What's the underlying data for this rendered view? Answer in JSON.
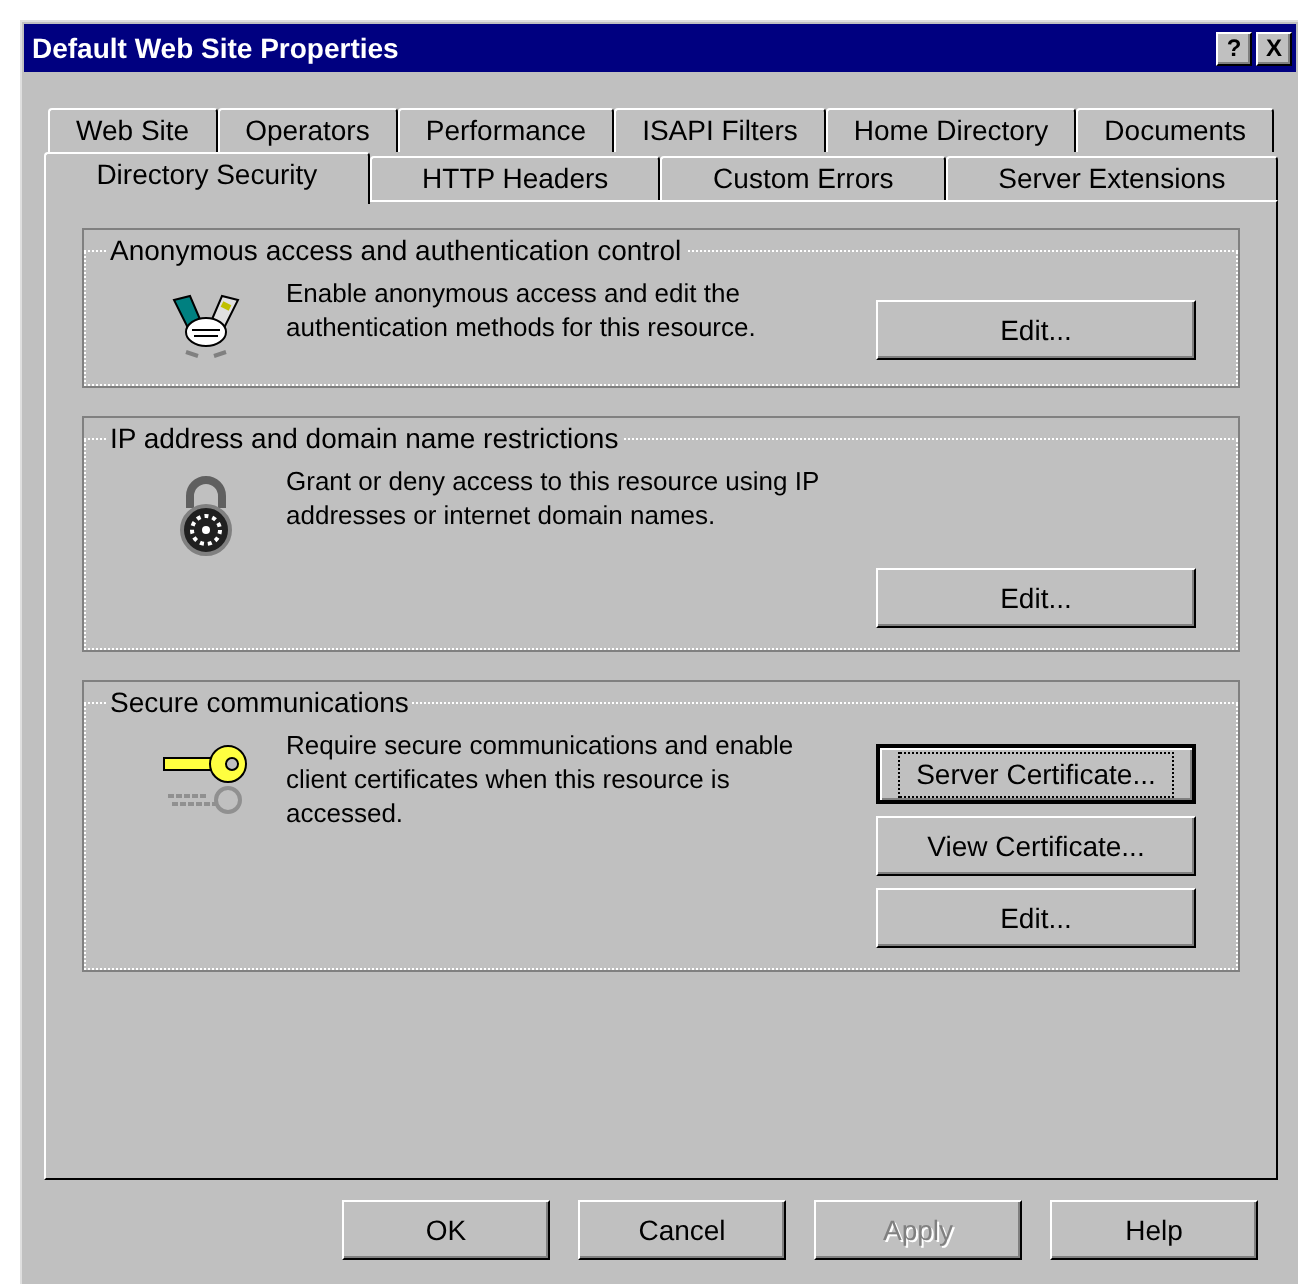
{
  "window": {
    "title": "Default Web Site Properties",
    "title_buttons": [
      "?",
      "X"
    ]
  },
  "tab_rows": [
    {
      "tabs": [
        {
          "label": "Web Site",
          "selected": false
        },
        {
          "label": "Operators",
          "selected": false
        },
        {
          "label": "Performance",
          "selected": false
        },
        {
          "label": "ISAPI Filters",
          "selected": false
        },
        {
          "label": "Home Directory",
          "selected": false
        },
        {
          "label": "Documents",
          "selected": false
        }
      ]
    },
    {
      "tabs": [
        {
          "label": "Directory Security",
          "selected": true
        },
        {
          "label": "HTTP Headers",
          "selected": false
        },
        {
          "label": "Custom Errors",
          "selected": false
        },
        {
          "label": "Server Extensions",
          "selected": false
        }
      ]
    }
  ],
  "groups": [
    {
      "title": "Anonymous access and authentication control",
      "kind": "handshake",
      "description": "Enable anonymous access and edit the authentication methods for this resource.",
      "buttons": [
        {
          "label": "Edit...",
          "focused": false
        }
      ]
    },
    {
      "title": "IP address and domain name restrictions",
      "kind": "lock",
      "description": "Grant or deny access to this resource using IP addresses or internet domain names.",
      "buttons": [
        {
          "label": "Edit...",
          "focused": false
        }
      ]
    },
    {
      "title": "Secure communications",
      "kind": "key",
      "description": "Require secure communications and enable client certificates when this resource is accessed.",
      "buttons": [
        {
          "label": "Server Certificate...",
          "focused": true
        },
        {
          "label": "View Certificate...",
          "focused": false
        },
        {
          "label": "Edit...",
          "focused": false
        }
      ]
    }
  ],
  "footer_buttons": [
    {
      "label": "OK",
      "disabled": false
    },
    {
      "label": "Cancel",
      "disabled": false
    },
    {
      "label": "Apply",
      "disabled": true
    },
    {
      "label": "Help",
      "disabled": false
    }
  ]
}
